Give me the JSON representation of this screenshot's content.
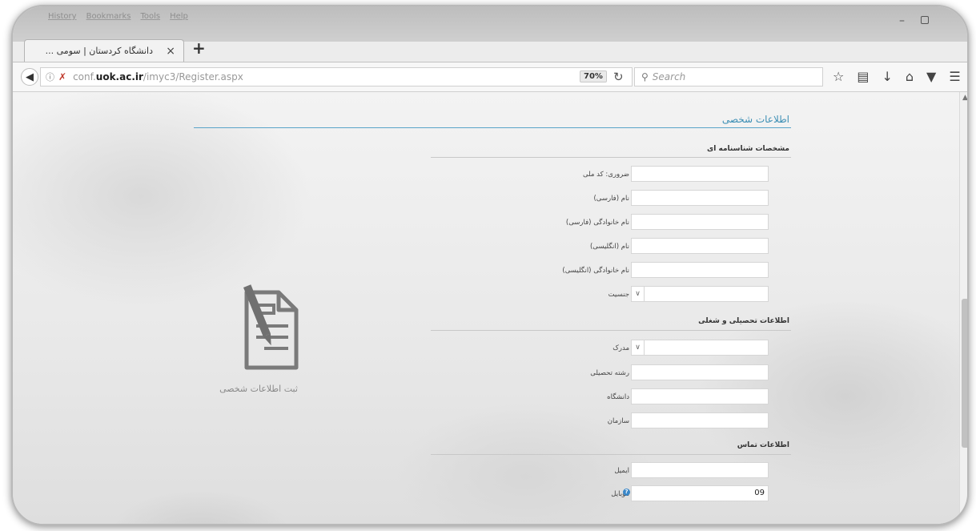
{
  "browser": {
    "menu": [
      "History",
      "Bookmarks",
      "Tools",
      "Help"
    ],
    "tab": {
      "title": "دانشگاه کردستان | سومی ...",
      "close_glyph": "×"
    },
    "new_tab_glyph": "+",
    "url": {
      "prefix": "conf.",
      "host": "uok.ac.ir",
      "path": "/imyc3/Register.aspx"
    },
    "zoom": "70%",
    "search_placeholder": "Search",
    "toolbar_icons": [
      "star-icon",
      "reader-icon",
      "download-icon",
      "home-icon",
      "pocket-icon",
      "menu-icon"
    ]
  },
  "page": {
    "section_title": "اطلاعات شخصی",
    "groups": [
      {
        "heading": "مشخصات شناسنامه ای",
        "fields": [
          {
            "label": "کد ملی",
            "prefix": "ضروری:",
            "type": "text",
            "value": ""
          },
          {
            "label": "نام (فارسی)",
            "type": "text",
            "value": ""
          },
          {
            "label": "نام خانوادگی (فارسی)",
            "type": "text",
            "value": ""
          },
          {
            "label": "نام (انگلیسی)",
            "type": "text",
            "value": ""
          },
          {
            "label": "نام خانوادگی (انگلیسی)",
            "type": "text",
            "value": ""
          },
          {
            "label": "جنسیت",
            "type": "select",
            "value": ""
          }
        ]
      },
      {
        "heading": "اطلاعات تحصیلی و شغلی",
        "fields": [
          {
            "label": "مدرک",
            "type": "select",
            "value": ""
          },
          {
            "label": "رشته تحصیلی",
            "type": "text",
            "value": ""
          },
          {
            "label": "دانشگاه",
            "type": "text",
            "value": ""
          },
          {
            "label": "سازمان",
            "type": "text",
            "value": ""
          }
        ]
      },
      {
        "heading": "اطلاعات تماس",
        "fields": [
          {
            "label": "ایمیل",
            "type": "text",
            "value": ""
          },
          {
            "label": "موبایل",
            "type": "text",
            "value": "09"
          }
        ]
      }
    ],
    "side_caption": "ثبت اطلاعات شخصی"
  }
}
